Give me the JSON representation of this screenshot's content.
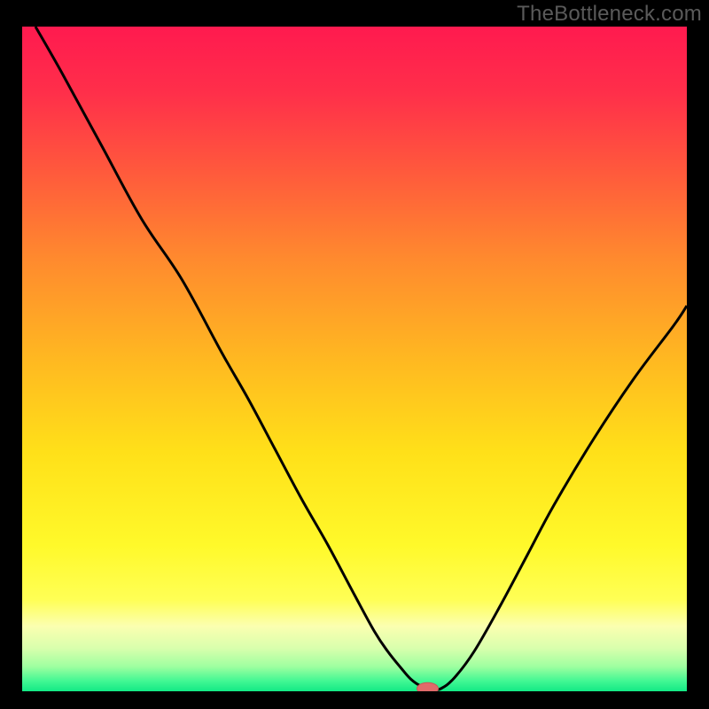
{
  "watermark": "TheBottleneck.com",
  "colors": {
    "background": "#000000",
    "gradient_stops": [
      {
        "offset": 0.0,
        "color": "#ff1a4f"
      },
      {
        "offset": 0.1,
        "color": "#ff2f4a"
      },
      {
        "offset": 0.22,
        "color": "#ff5a3c"
      },
      {
        "offset": 0.35,
        "color": "#ff8a2e"
      },
      {
        "offset": 0.5,
        "color": "#ffb821"
      },
      {
        "offset": 0.64,
        "color": "#ffe019"
      },
      {
        "offset": 0.78,
        "color": "#fff92a"
      },
      {
        "offset": 0.862,
        "color": "#ffff55"
      },
      {
        "offset": 0.902,
        "color": "#fbffb0"
      },
      {
        "offset": 0.935,
        "color": "#d9ffad"
      },
      {
        "offset": 0.963,
        "color": "#9effa0"
      },
      {
        "offset": 0.985,
        "color": "#40f793"
      },
      {
        "offset": 1.0,
        "color": "#13e985"
      }
    ],
    "curve": "#000000",
    "marker_fill": "#e06a6a",
    "marker_stroke": "#c95858"
  },
  "chart_data": {
    "type": "line",
    "title": "",
    "xlabel": "",
    "ylabel": "",
    "xlim": [
      0,
      100
    ],
    "ylim": [
      0,
      100
    ],
    "grid": false,
    "legend": false,
    "series": [
      {
        "name": "bottleneck-curve",
        "x": [
          2,
          6,
          12,
          18,
          24,
          30,
          34,
          38,
          42,
          46,
          50,
          53,
          55,
          57,
          58.5,
          60,
          62,
          63,
          65,
          68,
          72,
          76,
          80,
          86,
          92,
          98,
          100
        ],
        "y": [
          100,
          93,
          82,
          71,
          62,
          51,
          44,
          36.5,
          29,
          22,
          14.5,
          9,
          6,
          3.5,
          1.8,
          0.8,
          0.4,
          0.4,
          2,
          6,
          13,
          20.5,
          28,
          38,
          47,
          55,
          58
        ]
      }
    ],
    "marker": {
      "x": 61,
      "y": 0.4,
      "rx_pct": 1.6,
      "ry_pct": 0.9
    },
    "flat_segment": {
      "x_start": 57.5,
      "x_end": 63.5,
      "y": 0.4
    }
  }
}
